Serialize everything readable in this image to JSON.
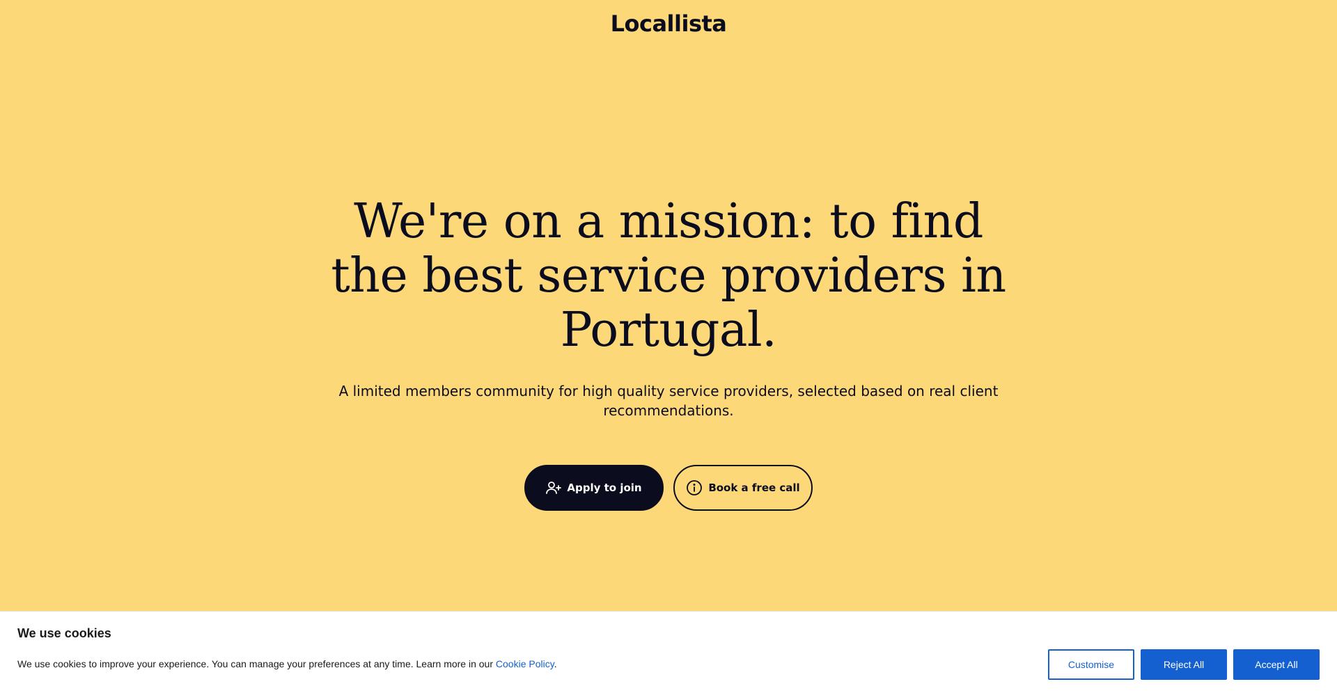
{
  "header": {
    "logo_text": "Locallista"
  },
  "hero": {
    "title": "We're on a mission: to find the best service providers in Portugal.",
    "subtitle": "A limited members community for high quality service providers, selected based on real client recommendations.",
    "primary_button": {
      "label": "Apply to join",
      "icon": "user-plus-icon"
    },
    "secondary_button": {
      "label": "Book a free call",
      "icon": "info-circle-icon"
    }
  },
  "cookie_banner": {
    "title": "We use cookies",
    "text_before_link": "We use cookies to improve your experience. You can manage your preferences at any time. Learn more in our ",
    "link_text": "Cookie Policy",
    "text_after_link": ".",
    "customise_label": "Customise",
    "reject_label": "Reject All",
    "accept_label": "Accept All"
  },
  "colors": {
    "background": "#fdd878",
    "ink": "#0b0d1f",
    "cookie_accent": "#1460d1"
  }
}
